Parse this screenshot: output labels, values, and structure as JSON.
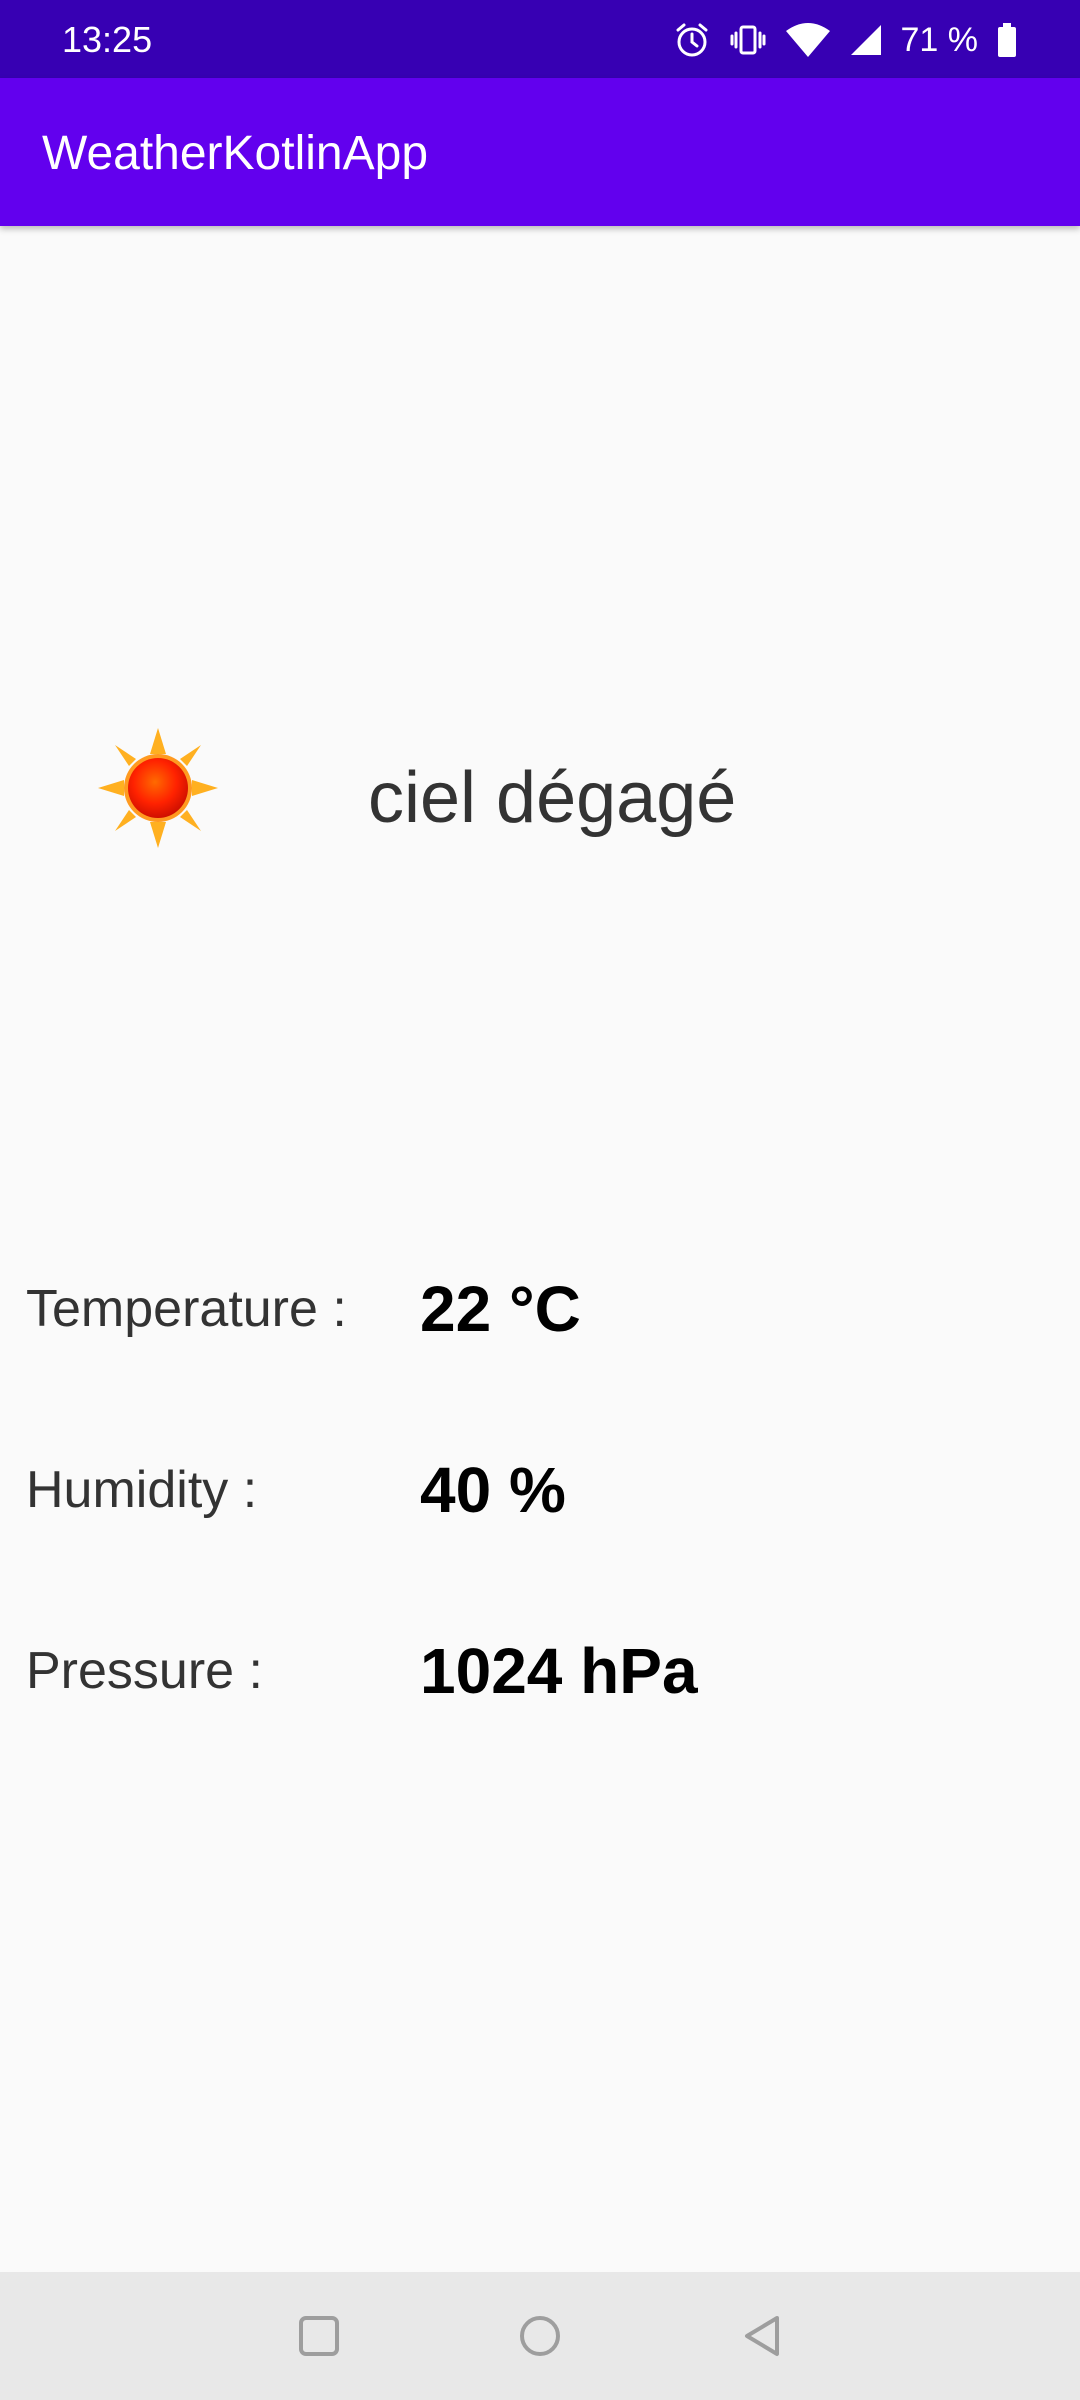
{
  "status_bar": {
    "time": "13:25",
    "battery_percent": "71 %",
    "icons": [
      "alarm-icon",
      "vibrate-icon",
      "wifi-icon",
      "cell-signal-icon",
      "battery-icon"
    ]
  },
  "app_bar": {
    "title": "WeatherKotlinApp",
    "color": "#6200ee",
    "status_color": "#3700b3"
  },
  "weather": {
    "icon": "sun-icon",
    "description": "ciel dégagé"
  },
  "details": {
    "temperature_label": "Temperature :",
    "temperature_value": "22 °C",
    "humidity_label": "Humidity :",
    "humidity_value": "40 %",
    "pressure_label": "Pressure :",
    "pressure_value": "1024 hPa"
  },
  "nav_bar": {
    "buttons": [
      "recents-icon",
      "home-icon",
      "back-icon"
    ]
  }
}
